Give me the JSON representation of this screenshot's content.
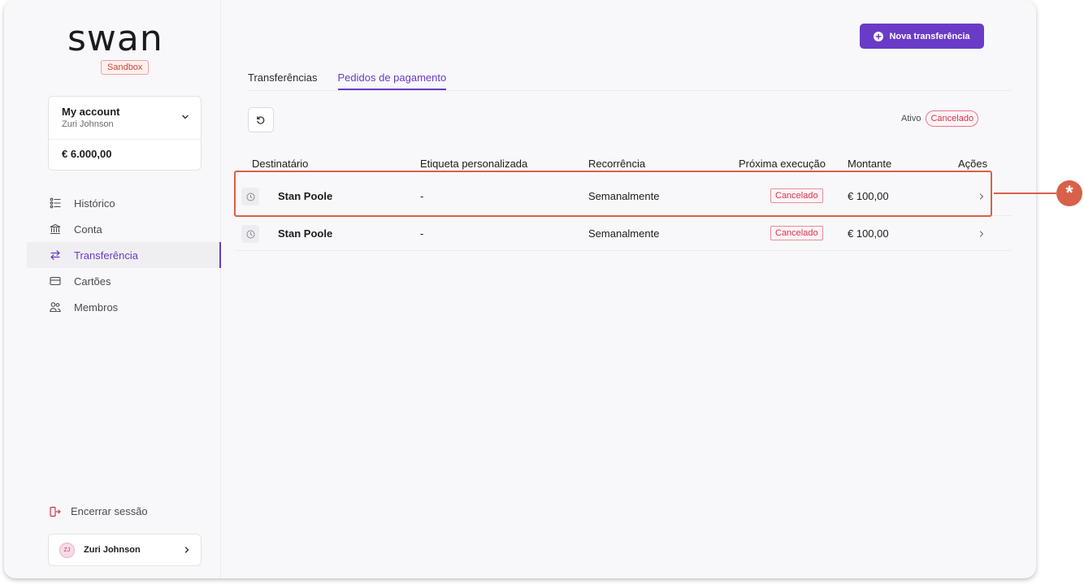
{
  "brand": {
    "logo_text": "swan",
    "env_badge": "Sandbox"
  },
  "account": {
    "name": "My account",
    "holder": "Zuri Johnson",
    "balance": "€ 6.000,00"
  },
  "nav": {
    "items": [
      {
        "label": "Histórico",
        "icon": "list-icon"
      },
      {
        "label": "Conta",
        "icon": "bank-icon"
      },
      {
        "label": "Transferência",
        "icon": "transfer-arrows-icon",
        "active": true
      },
      {
        "label": "Cartões",
        "icon": "card-icon"
      },
      {
        "label": "Membros",
        "icon": "people-icon"
      }
    ],
    "logout_label": "Encerrar sessão"
  },
  "user": {
    "initials": "ZJ",
    "name": "Zuri Johnson"
  },
  "toolbar": {
    "new_transfer_label": "Nova transferência"
  },
  "tabs": [
    {
      "label": "Transferências",
      "active": false
    },
    {
      "label": "Pedidos de pagamento",
      "active": true
    }
  ],
  "filters": {
    "active_label": "Ativo",
    "canceled_label": "Cancelado",
    "selected": "Cancelado"
  },
  "table": {
    "headers": {
      "recipient": "Destinatário",
      "custom_label": "Etiqueta personalizada",
      "recurrence": "Recorrência",
      "next_execution": "Próxima execução",
      "amount": "Montante",
      "actions": "Ações"
    },
    "rows": [
      {
        "recipient": "Stan Poole",
        "custom_label": "-",
        "recurrence": "Semanalmente",
        "status": "Cancelado",
        "amount": "€ 100,00"
      },
      {
        "recipient": "Stan Poole",
        "custom_label": "-",
        "recurrence": "Semanalmente",
        "status": "Cancelado",
        "amount": "€ 100,00"
      }
    ]
  },
  "annotation": {
    "marker": "*"
  },
  "colors": {
    "accent": "#6a3bc7",
    "danger": "#d2344f",
    "callout": "#d9604b"
  }
}
